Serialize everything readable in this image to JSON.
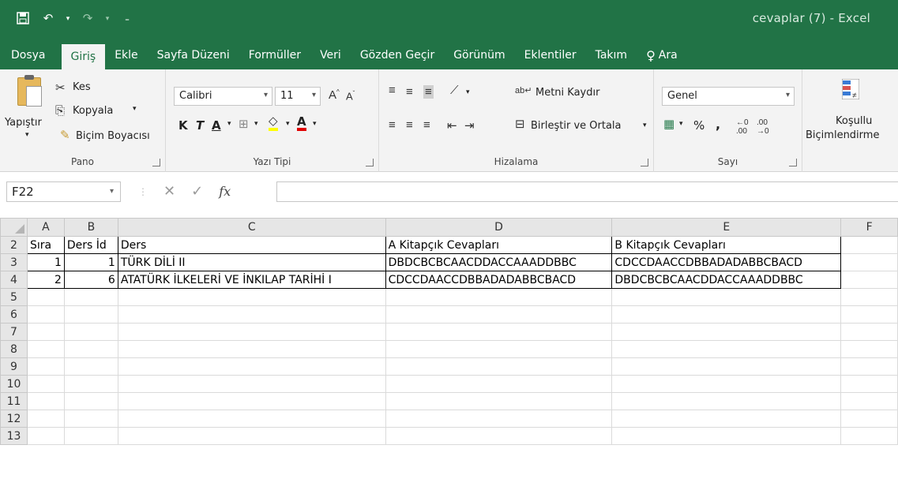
{
  "window": {
    "title": "cevaplar (7)  -  Excel"
  },
  "qat": {
    "save_icon": "save-icon",
    "undo_icon": "undo-icon",
    "redo_icon": "redo-icon",
    "customize_icon": "customize-qat-icon"
  },
  "tabs": [
    {
      "label": "Dosya"
    },
    {
      "label": "Giriş"
    },
    {
      "label": "Ekle"
    },
    {
      "label": "Sayfa Düzeni"
    },
    {
      "label": "Formüller"
    },
    {
      "label": "Veri"
    },
    {
      "label": "Gözden Geçir"
    },
    {
      "label": "Görünüm"
    },
    {
      "label": "Eklentiler"
    },
    {
      "label": "Takım"
    },
    {
      "label": "Ara"
    }
  ],
  "ribbon": {
    "pano": {
      "label": "Pano",
      "paste": "Yapıştır",
      "cut": "Kes",
      "copy": "Kopyala",
      "format_painter": "Biçim Boyacısı"
    },
    "font": {
      "label": "Yazı Tipi",
      "name": "Calibri",
      "size": "11",
      "bold": "K",
      "italic": "T",
      "underline": "A",
      "font_color": "A"
    },
    "alignment": {
      "label": "Hizalama",
      "wrap": "Metni Kaydır",
      "merge": "Birleştir ve Ortala"
    },
    "number": {
      "label": "Sayı",
      "format": "Genel",
      "percent": "%",
      "comma": ","
    },
    "styles": {
      "conditional_line1": "Koşullu",
      "conditional_line2": "Biçimlendirme"
    }
  },
  "formula_bar": {
    "name_box": "F22",
    "fx": "fx",
    "value": ""
  },
  "sheet": {
    "columns": [
      "A",
      "B",
      "C",
      "D",
      "E",
      "F"
    ],
    "rows": [
      {
        "n": "2",
        "cells": [
          "Sıra",
          "Ders İd",
          "Ders",
          "A Kitapçık Cevapları",
          "B Kitapçık Cevapları",
          ""
        ]
      },
      {
        "n": "3",
        "cells": [
          "1",
          "1",
          "TÜRK DİLİ II",
          "DBDCBCBCAACDDACCAAADDBBC",
          "CDCCDAACCDBBADADABBCBACD",
          ""
        ]
      },
      {
        "n": "4",
        "cells": [
          "2",
          "6",
          "ATATÜRK İLKELERİ VE İNKILAP TARİHİ I",
          "CDCCDAACCDBBADADABBCBACD",
          "DBDCBCBCAACDDACCAAADDBBC",
          ""
        ]
      },
      {
        "n": "5",
        "cells": [
          "",
          "",
          "",
          "",
          "",
          ""
        ]
      },
      {
        "n": "6",
        "cells": [
          "",
          "",
          "",
          "",
          "",
          ""
        ]
      },
      {
        "n": "7",
        "cells": [
          "",
          "",
          "",
          "",
          "",
          ""
        ]
      },
      {
        "n": "8",
        "cells": [
          "",
          "",
          "",
          "",
          "",
          ""
        ]
      },
      {
        "n": "9",
        "cells": [
          "",
          "",
          "",
          "",
          "",
          ""
        ]
      },
      {
        "n": "10",
        "cells": [
          "",
          "",
          "",
          "",
          "",
          ""
        ]
      },
      {
        "n": "11",
        "cells": [
          "",
          "",
          "",
          "",
          "",
          ""
        ]
      },
      {
        "n": "12",
        "cells": [
          "",
          "",
          "",
          "",
          "",
          ""
        ]
      },
      {
        "n": "13",
        "cells": [
          "",
          "",
          "",
          "",
          "",
          ""
        ]
      }
    ]
  },
  "colors": {
    "brand": "#217346",
    "ribbon_bg": "#f3f3f3",
    "header_bg": "#e6e6e6"
  }
}
